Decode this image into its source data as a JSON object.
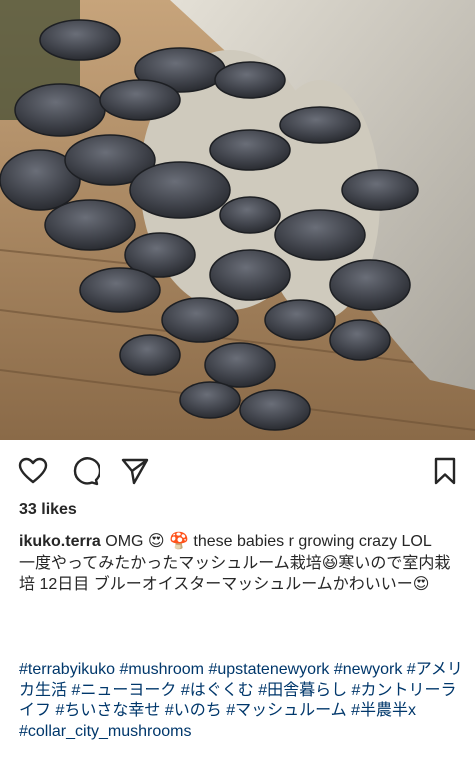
{
  "post": {
    "likes": "33 likes",
    "username": "ikuko.terra",
    "caption_line1": " OMG 😍 🍄 these babies r growing crazy LOL",
    "caption_line2": "一度やってみたかったマッシュルーム栽培😆寒いので室内栽培 12日目 ブルーオイスターマッシュルームかわいいー😍",
    "hashtags": [
      "#terrabyikuko",
      "#mushroom",
      "#upstatenewyork",
      "#newyork",
      "#アメリカ生活",
      "#ニューヨーク",
      "#はぐくむ",
      "#田舎暮らし",
      "#カントリーライフ",
      "#ちいさな幸せ",
      "#いのち",
      "#マッシュルーム",
      "#半農半x",
      "#collar_city_mushrooms"
    ]
  },
  "icons": {
    "like": "heart-icon",
    "comment": "comment-icon",
    "share": "send-icon",
    "save": "bookmark-icon"
  },
  "colors": {
    "text": "#262626",
    "hashtag": "#00376b",
    "mushroom_cap": "#3a3d44",
    "mushroom_gill": "#b9b4aa"
  }
}
